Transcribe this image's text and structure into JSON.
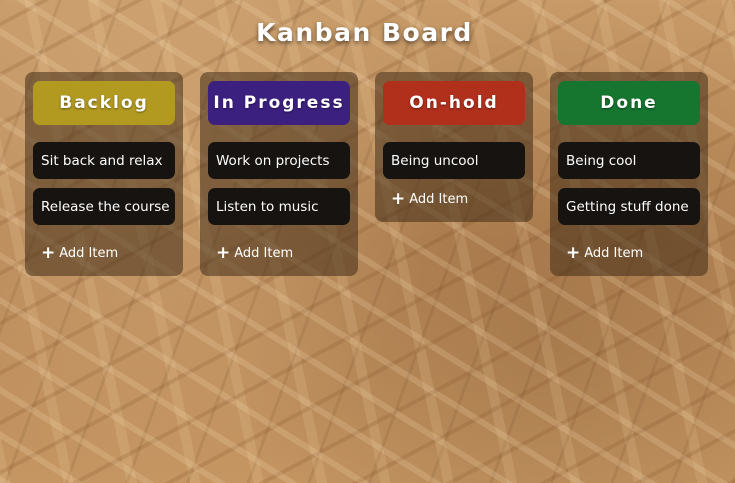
{
  "title": "Kanban Board",
  "columns": [
    {
      "label": "Backlog",
      "color": "#b29a21",
      "items": [
        "Sit back and relax",
        "Release the course"
      ],
      "add_label": "Add Item"
    },
    {
      "label": "In Progress",
      "color": "#3c2080",
      "items": [
        "Work on projects",
        "Listen to music"
      ],
      "add_label": "Add Item"
    },
    {
      "label": "On-hold",
      "color": "#b1301c",
      "items": [
        "Being uncool"
      ],
      "add_label": "Add Item"
    },
    {
      "label": "Done",
      "color": "#16752f",
      "items": [
        "Being cool",
        "Getting stuff done"
      ],
      "add_label": "Add Item"
    }
  ],
  "icons": {
    "add": "plus-icon"
  }
}
